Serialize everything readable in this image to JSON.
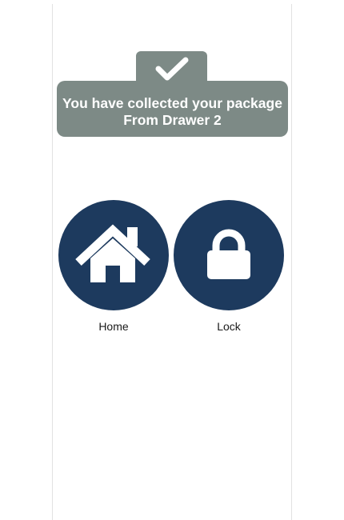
{
  "notification": {
    "icon": "checkmark-icon",
    "line1": "You have collected your package",
    "line2": "From Drawer 2",
    "background": "#7d8a86"
  },
  "actions": {
    "home": {
      "label": "Home",
      "icon": "home-icon"
    },
    "lock": {
      "label": "Lock",
      "icon": "lock-icon"
    }
  },
  "colors": {
    "accent": "#1d3a5e",
    "icon_fill": "#ffffff"
  }
}
